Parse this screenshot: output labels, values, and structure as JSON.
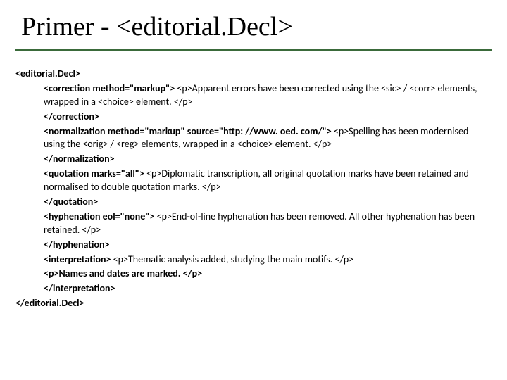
{
  "title": "Primer - <editorial.Decl>",
  "open": "<editorial.Decl>",
  "l1b": "<correction method=\"markup\">",
  "l1t": " <p>Apparent errors have been corrected using the <sic> / <corr> elements, wrapped in a <choice> element. </p>",
  "l1c": "</correction>",
  "l2b": "<normalization method=\"markup\" source=\"http: //www. oed. com/\">",
  "l2t": " <p>Spelling has been modernised using the <orig> / <reg> elements, wrapped in a <choice> element. </p>",
  "l2c": "</normalization>",
  "l3b": "<quotation marks=\"all\">",
  "l3t": " <p>Diplomatic transcription, all original quotation marks have been retained and normalised to double quotation marks. </p>",
  "l3c": "</quotation>",
  "l4b": "<hyphenation eol=\"none\">",
  "l4t": " <p>End-of-line hyphenation has been removed. All other hyphenation has been retained. </p>",
  "l4c": "</hyphenation>",
  "l5b": "<interpretation>",
  "l5t": " <p>Thematic analysis added, studying the main motifs. </p>",
  "l5p2": "<p>Names and dates are marked. </p>",
  "l5c": "</interpretation>",
  "close": "</editorial.Decl>"
}
